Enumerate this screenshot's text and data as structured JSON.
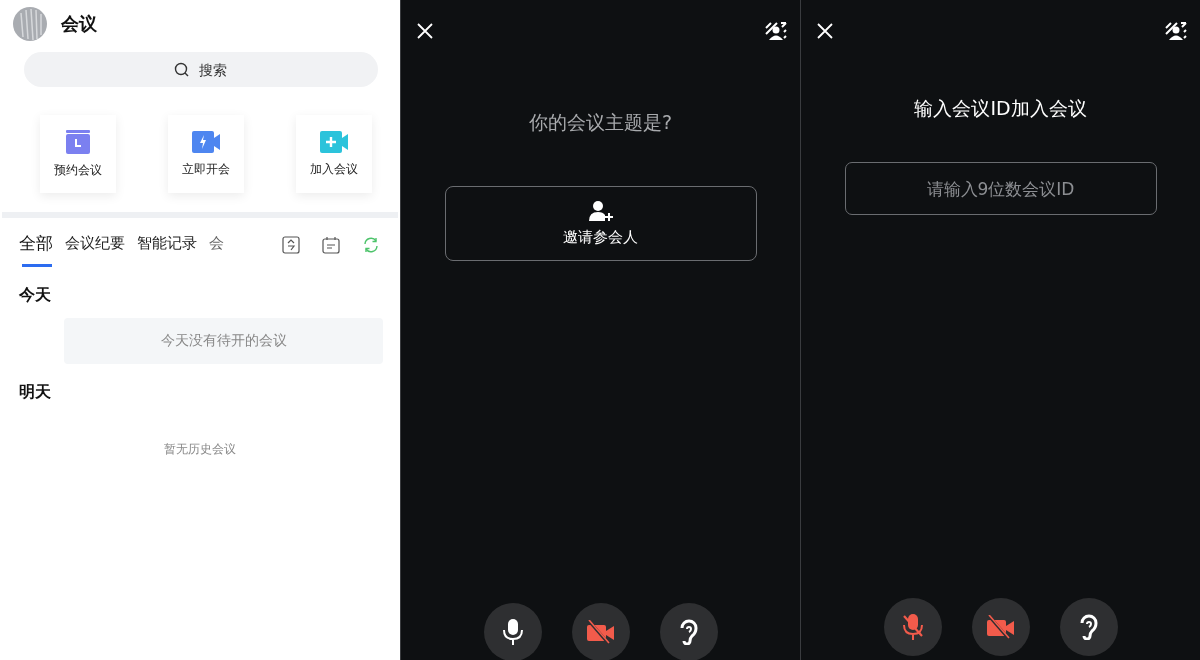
{
  "home": {
    "title": "会议",
    "search": {
      "placeholder": "搜索"
    },
    "actions": [
      {
        "kind": "schedule",
        "label": "预约会议"
      },
      {
        "kind": "instant",
        "label": "立即开会"
      },
      {
        "kind": "join",
        "label": "加入会议"
      }
    ],
    "tabs": [
      {
        "label": "全部",
        "selected": true
      },
      {
        "label": "会议纪要",
        "selected": false
      },
      {
        "label": "智能记录",
        "selected": false
      },
      {
        "label": "会",
        "selected": false
      }
    ],
    "sections": [
      {
        "title": "今天",
        "empty_text": "今天没有待开的会议"
      },
      {
        "title": "明天"
      }
    ],
    "history_empty": "暂无历史会议"
  },
  "new_meeting": {
    "prompt": "你的会议主题是?",
    "invite_button": "邀请参会人",
    "controls": [
      {
        "kind": "mic",
        "on": true
      },
      {
        "kind": "camera",
        "on": false
      },
      {
        "kind": "ear"
      }
    ]
  },
  "join_meeting": {
    "title": "输入会议ID加入会议",
    "id_field": {
      "placeholder": "请输入9位数会议ID"
    },
    "controls": [
      {
        "kind": "mic",
        "on": false
      },
      {
        "kind": "camera",
        "on": false
      },
      {
        "kind": "ear"
      }
    ]
  }
}
